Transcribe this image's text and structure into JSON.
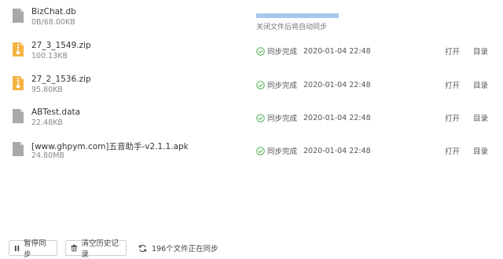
{
  "files": [
    {
      "name": "BizChat.db",
      "size": "0B/68.00KB",
      "icon": "doc-icon",
      "state": "syncing",
      "progress_fraction": 1.0,
      "pending_text": "关闭文件后将自动同步"
    },
    {
      "name": "27_3_1549.zip",
      "size": "100.13KB",
      "icon": "zip-icon",
      "state": "done",
      "status_label": "同步完成",
      "time": "2020-01-04 22:48",
      "open_label": "打开",
      "dir_label": "目录"
    },
    {
      "name": "27_2_1536.zip",
      "size": "95.80KB",
      "icon": "zip-icon",
      "state": "done",
      "status_label": "同步完成",
      "time": "2020-01-04 22:48",
      "open_label": "打开",
      "dir_label": "目录"
    },
    {
      "name": "ABTest.data",
      "size": "22.48KB",
      "icon": "doc-icon",
      "state": "done",
      "status_label": "同步完成",
      "time": "2020-01-04 22:48",
      "open_label": "打开",
      "dir_label": "目录"
    },
    {
      "name": "[www.ghpym.com]五音助手-v2.1.1.apk",
      "size": "24.80MB",
      "icon": "doc-icon",
      "state": "done",
      "status_label": "同步完成",
      "time": "2020-01-04 22:48",
      "open_label": "打开",
      "dir_label": "目录"
    }
  ],
  "footer": {
    "pause_label": "暂停同步",
    "clear_label": "清空历史记录",
    "sync_status": "196个文件正在同步"
  },
  "colors": {
    "success": "#4caf50",
    "zip": "#f5b342",
    "doc": "#9e9e9e",
    "progress": "#a7c8ec"
  }
}
